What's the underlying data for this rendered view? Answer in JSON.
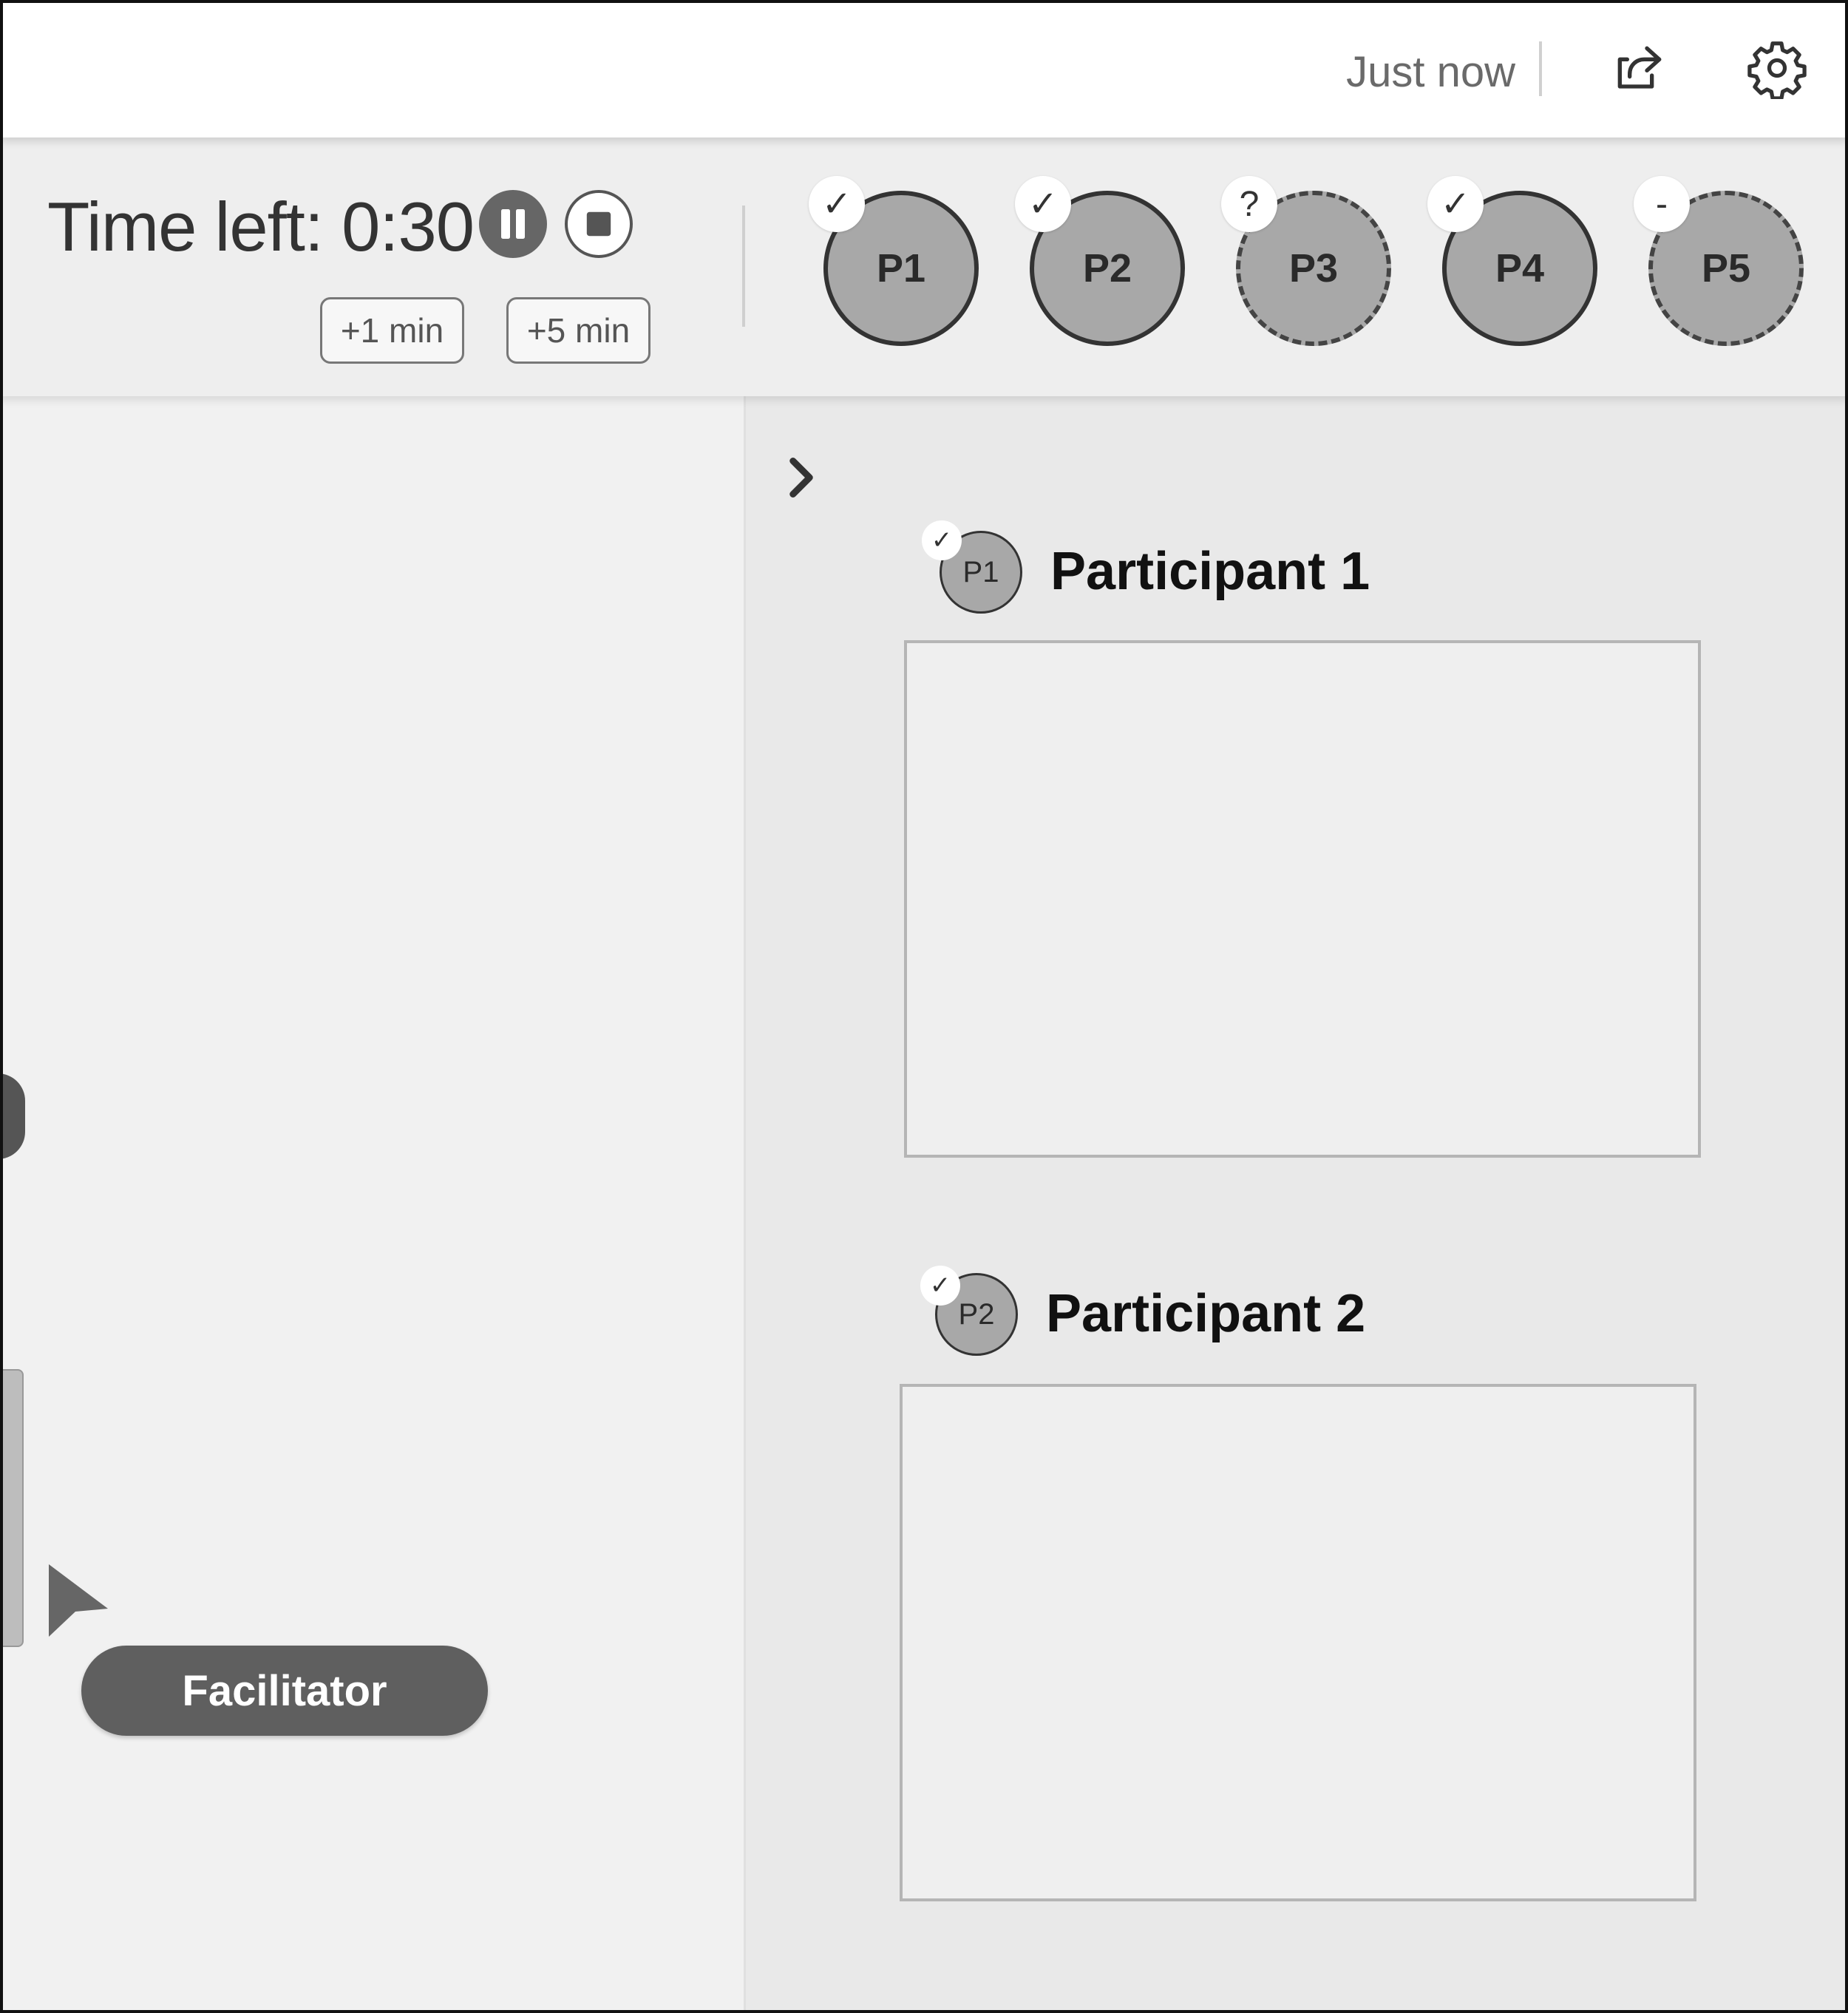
{
  "header": {
    "save_status": "Just now",
    "share_icon": "share-icon",
    "settings_icon": "gear-icon"
  },
  "timer": {
    "label": "Time left: 0:30",
    "pause_icon": "pause-icon",
    "stop_icon": "stop-icon",
    "add_one": "+1 min",
    "add_five": "+5 min"
  },
  "participants": [
    {
      "label": "P1",
      "status": "✓",
      "state": "done"
    },
    {
      "label": "P2",
      "status": "✓",
      "state": "done"
    },
    {
      "label": "P3",
      "status": "?",
      "state": "pending"
    },
    {
      "label": "P4",
      "status": "✓",
      "state": "done"
    },
    {
      "label": "P5",
      "status": "-",
      "state": "pending"
    }
  ],
  "canvas": {
    "cursor_label": "Facilitator"
  },
  "panel": {
    "collapse_icon": "chevron-right-icon",
    "entries": [
      {
        "avatar": "P1",
        "check": "✓",
        "name": "Participant 1"
      },
      {
        "avatar": "P2",
        "check": "✓",
        "name": "Participant 2"
      }
    ]
  },
  "colors": {
    "avatar_fill": "#a8a8a8",
    "panel_bg": "#e9e9e9",
    "cursor_tag": "#5f5f5f"
  }
}
